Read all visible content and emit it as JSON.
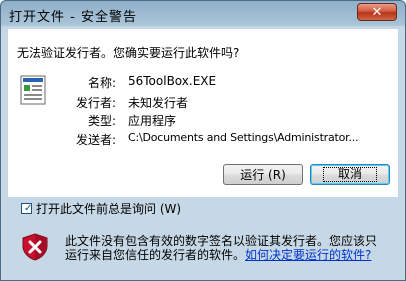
{
  "window": {
    "title": "打开文件 - 安全警告",
    "close_symbol": "✕"
  },
  "dialog": {
    "heading": "无法验证发行者。您确实要运行此软件吗?",
    "file_icon": "document-icon",
    "details": [
      {
        "label": "名称:",
        "value": "56ToolBox.EXE"
      },
      {
        "label": "发行者:",
        "value": "未知发行者"
      },
      {
        "label": "类型:",
        "value": "应用程序"
      },
      {
        "label": "发送者:",
        "value": "C:\\Documents and Settings\\Administrator..."
      }
    ],
    "buttons": {
      "run": "运行 (R)",
      "cancel": "取消"
    },
    "checkbox": {
      "label": "打开此文件前总是询问 (W)",
      "checked": true
    },
    "warning": {
      "icon": "shield-error-icon",
      "text": "此文件没有包含有效的数字签名以验证其发行者。您应该只运行来自您信任的发行者的软件。",
      "link": "如何决定要运行的软件?"
    }
  },
  "colors": {
    "link": "#0033cc",
    "close_button": "#c4472b",
    "shield_red": "#c8102e"
  }
}
